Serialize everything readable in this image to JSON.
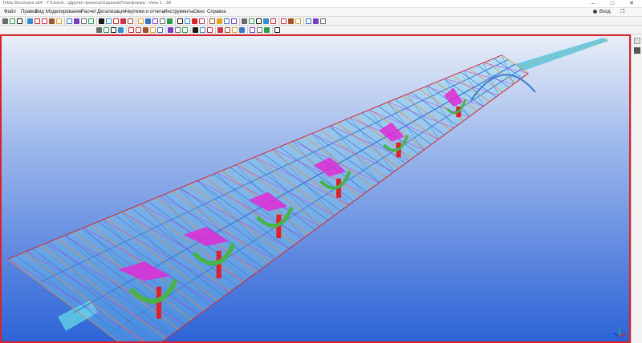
{
  "app": {
    "title": "Tekla Structures x64 - Y:\\Users\\...\\Другие проекты\\Харьков\\Платформа - View 1 - 3d",
    "window_controls": {
      "minimize": "–",
      "maximize": "□",
      "close": "✕"
    }
  },
  "menu": {
    "items": [
      "Файл",
      "Правка",
      "Вид",
      "Моделирование",
      "Расчет",
      "Детализация",
      "Чертежи и отчеты",
      "Инструменты",
      "Окно",
      "Справка"
    ],
    "user_label": "Вход"
  },
  "toolbar": {
    "row1_icons": [
      "new-icon",
      "open-icon",
      "save-icon",
      "undo-icon",
      "redo-icon",
      "settings-icon",
      "gear-icon",
      "shape-icon",
      "catalog-icon",
      "import-icon",
      "export-icon",
      "selection-icon",
      "window-icon",
      "layout-icon",
      "beam-icon",
      "column-icon",
      "plate-icon",
      "bolt-icon",
      "weld-icon",
      "part-icon",
      "cut-icon",
      "fit-icon",
      "component-icon",
      "drawing-icon",
      "report-icon",
      "color-icon",
      "sketch-icon",
      "pick-icon",
      "snap-icon",
      "grid-icon",
      "plane-icon",
      "line-icon",
      "measure-icon",
      "zoom-icon",
      "pan-icon",
      "rotate-icon",
      "clip-icon",
      "view-icon",
      "render-icon",
      "lock-icon",
      "help-icon"
    ],
    "row2_icons": [
      "select-all-icon",
      "select-part-icon",
      "select-assembly-icon",
      "select-component-icon",
      "select-bolt-icon",
      "select-weld-icon",
      "select-grid-icon",
      "select-plane-icon",
      "filter-icon",
      "snap-end-icon",
      "snap-mid-icon",
      "snap-center-icon",
      "snap-intersect-icon",
      "snap-perp-icon",
      "snap-line-icon",
      "snap-point-icon",
      "snap-any-icon",
      "snap-reference-icon",
      "snap-geometry-icon",
      "snap-edge-icon",
      "snap-nearest-icon",
      "snap-extension-icon",
      "snap-orth-icon"
    ]
  },
  "side_panel": {
    "icons": [
      "properties-icon",
      "views-icon"
    ]
  },
  "viewport": {
    "label": "View 1 - 3d",
    "frame_color": "#d8232a",
    "background_top": "#e8eef8",
    "background_bottom": "#2a64d8",
    "model": "station platform roof steel structure"
  },
  "colors": {
    "beam_blue": "#3b7fd4",
    "brace_red": "#d8232a",
    "column_red": "#e0202a",
    "brace_magenta": "#e02ad6",
    "arch_green": "#48b34a",
    "purlin_orange": "#f08a2a",
    "deck_cyan": "#5cc8e6"
  }
}
